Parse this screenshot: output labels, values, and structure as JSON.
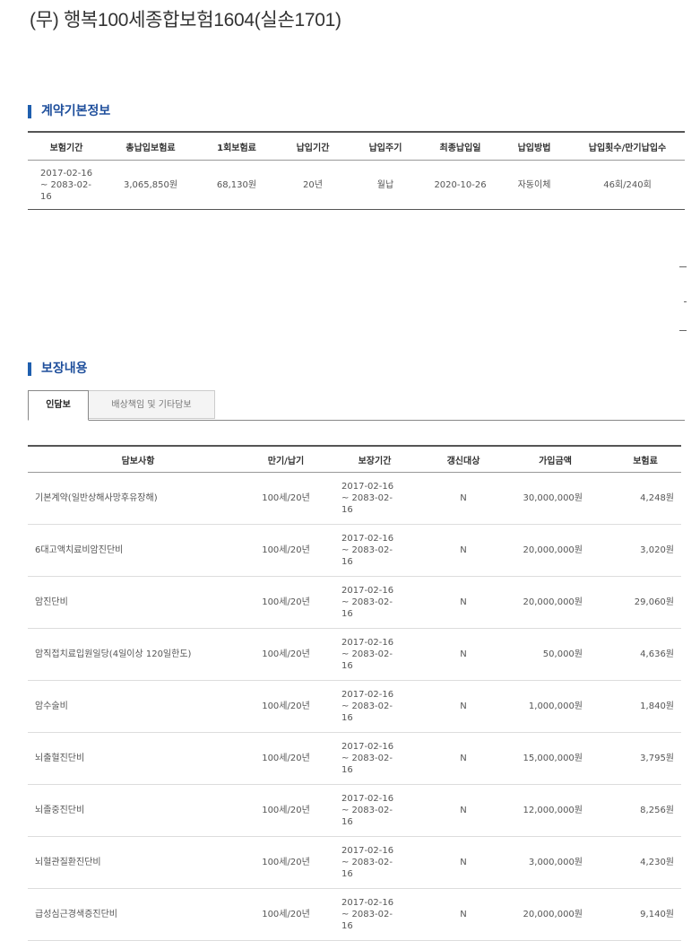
{
  "page_title": "(무) 행복100세종합보험1604(실손1701)",
  "basic_section": {
    "heading": "계약기본정보",
    "columns": [
      "보험기간",
      "총납입보험료",
      "1회보험료",
      "납입기간",
      "납입주기",
      "최종납입일",
      "납입방법",
      "납입횟수/만기납입수"
    ],
    "row": {
      "period_line1": "2017-02-16",
      "period_line2": "~ 2083-02-",
      "period_line3": "16",
      "total_paid": "3,065,850원",
      "premium_per_payment": "68,130원",
      "payment_term": "20년",
      "payment_cycle": "월납",
      "last_paid_date": "2020-10-26",
      "payment_method": "자동이체",
      "payment_count": "46회/240회"
    }
  },
  "coverage_section": {
    "heading": "보장내용",
    "tabs": [
      "인담보",
      "배상책임 및 기타담보"
    ],
    "columns": [
      "담보사항",
      "만기/납기",
      "보장기간",
      "갱신대상",
      "가입금액",
      "보험료"
    ],
    "rows": [
      {
        "name": "기본계약(일반상해사망후유장해)",
        "term": "100세/20년",
        "p1": "2017-02-16",
        "p2": "~ 2083-02-",
        "p3": "16",
        "renew": "N",
        "amount": "30,000,000원",
        "premium": "4,248원"
      },
      {
        "name": "6대고액치료비암진단비",
        "term": "100세/20년",
        "p1": "2017-02-16",
        "p2": "~ 2083-02-",
        "p3": "16",
        "renew": "N",
        "amount": "20,000,000원",
        "premium": "3,020원"
      },
      {
        "name": "암진단비",
        "term": "100세/20년",
        "p1": "2017-02-16",
        "p2": "~ 2083-02-",
        "p3": "16",
        "renew": "N",
        "amount": "20,000,000원",
        "premium": "29,060원"
      },
      {
        "name": "암직접치료입원일당(4일이상 120일한도)",
        "term": "100세/20년",
        "p1": "2017-02-16",
        "p2": "~ 2083-02-",
        "p3": "16",
        "renew": "N",
        "amount": "50,000원",
        "premium": "4,636원"
      },
      {
        "name": "암수술비",
        "term": "100세/20년",
        "p1": "2017-02-16",
        "p2": "~ 2083-02-",
        "p3": "16",
        "renew": "N",
        "amount": "1,000,000원",
        "premium": "1,840원"
      },
      {
        "name": "뇌출혈진단비",
        "term": "100세/20년",
        "p1": "2017-02-16",
        "p2": "~ 2083-02-",
        "p3": "16",
        "renew": "N",
        "amount": "15,000,000원",
        "premium": "3,795원"
      },
      {
        "name": "뇌졸중진단비",
        "term": "100세/20년",
        "p1": "2017-02-16",
        "p2": "~ 2083-02-",
        "p3": "16",
        "renew": "N",
        "amount": "12,000,000원",
        "premium": "8,256원"
      },
      {
        "name": "뇌혈관질환진단비",
        "term": "100세/20년",
        "p1": "2017-02-16",
        "p2": "~ 2083-02-",
        "p3": "16",
        "renew": "N",
        "amount": "3,000,000원",
        "premium": "4,230원"
      },
      {
        "name": "급성심근경색증진단비",
        "term": "100세/20년",
        "p1": "2017-02-16",
        "p2": "~ 2083-02-",
        "p3": "16",
        "renew": "N",
        "amount": "20,000,000원",
        "premium": "9,140원"
      }
    ]
  }
}
